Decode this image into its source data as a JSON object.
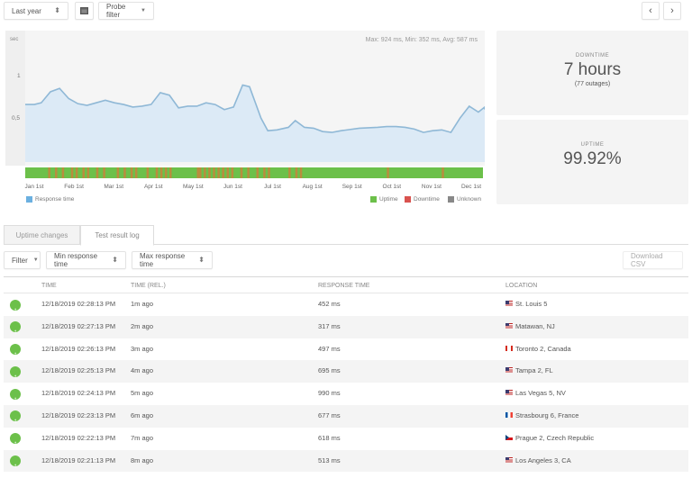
{
  "toolbar": {
    "range_select": "Last year",
    "calendar_icon": "calendar-icon",
    "probe_filter": "Probe filter",
    "prev_icon": "chevron-left-icon",
    "next_icon": "chevron-right-icon",
    "prev_glyph": "‹",
    "next_glyph": "›",
    "sort_glyph": "⬍",
    "caret_glyph": "▼"
  },
  "chart": {
    "summary": "Max: 924 ms, Min: 352 ms, Avg: 587 ms",
    "legend_response": "Response time",
    "legend_uptime": "Uptime",
    "legend_downtime": "Downtime",
    "legend_unknown": "Unknown",
    "colors": {
      "line": "#8fb8d6",
      "fill": "#dceaf6",
      "uptime": "#6cc04a",
      "downtime": "#d9534f",
      "partial": "#c8823c",
      "unknown": "#888888",
      "response_legend": "#6bb0e0"
    }
  },
  "chart_data": {
    "type": "area",
    "title": "",
    "ylabel": "sec",
    "ytick_labels": [
      "sec",
      "1",
      "0,5"
    ],
    "ylim": [
      0,
      1.5
    ],
    "x_labels": [
      "Jan 1st",
      "Feb 1st",
      "Mar 1st",
      "Apr 1st",
      "May 1st",
      "Jun 1st",
      "Jul 1st",
      "Aug 1st",
      "Sep 1st",
      "Oct 1st",
      "Nov 1st",
      "Dec 1st"
    ],
    "x_range": [
      0,
      1
    ],
    "series": [
      {
        "name": "Response time",
        "x": [
          0,
          0.02,
          0.035,
          0.055,
          0.075,
          0.095,
          0.115,
          0.135,
          0.155,
          0.175,
          0.195,
          0.215,
          0.235,
          0.255,
          0.275,
          0.295,
          0.315,
          0.335,
          0.355,
          0.375,
          0.395,
          0.415,
          0.435,
          0.455,
          0.475,
          0.49,
          0.515,
          0.53,
          0.55,
          0.575,
          0.59,
          0.61,
          0.63,
          0.65,
          0.67,
          0.69,
          0.73,
          0.77,
          0.79,
          0.81,
          0.83,
          0.85,
          0.87,
          0.89,
          0.91,
          0.93,
          0.95,
          0.97,
          0.99,
          1.01,
          1.025
        ],
        "values": [
          0.68,
          0.68,
          0.7,
          0.83,
          0.87,
          0.75,
          0.69,
          0.67,
          0.7,
          0.73,
          0.7,
          0.68,
          0.65,
          0.66,
          0.68,
          0.82,
          0.79,
          0.64,
          0.66,
          0.66,
          0.7,
          0.68,
          0.62,
          0.65,
          0.91,
          0.89,
          0.52,
          0.37,
          0.38,
          0.41,
          0.49,
          0.41,
          0.4,
          0.36,
          0.35,
          0.37,
          0.4,
          0.41,
          0.42,
          0.42,
          0.41,
          0.39,
          0.35,
          0.37,
          0.38,
          0.35,
          0.52,
          0.66,
          0.59,
          0.65,
          0.62
        ]
      }
    ],
    "status_bar": {
      "legend": [
        "Uptime",
        "Downtime",
        "Unknown"
      ],
      "partial_outage_positions": [
        0.05,
        0.065,
        0.08,
        0.1,
        0.11,
        0.125,
        0.135,
        0.155,
        0.17,
        0.2,
        0.215,
        0.23,
        0.24,
        0.265,
        0.285,
        0.295,
        0.305,
        0.315,
        0.375,
        0.38,
        0.39,
        0.4,
        0.41,
        0.42,
        0.43,
        0.44,
        0.45,
        0.47,
        0.485,
        0.505,
        0.52,
        0.53,
        0.575,
        0.59,
        0.6,
        0.79,
        0.91
      ]
    }
  },
  "stats": {
    "downtime_label": "DOWNTIME",
    "downtime_value": "7 hours",
    "downtime_sub": "(77 outages)",
    "uptime_label": "UPTIME",
    "uptime_value": "99.92%"
  },
  "tabs": [
    {
      "label": "Uptime changes",
      "active": false
    },
    {
      "label": "Test result log",
      "active": true
    }
  ],
  "filters": {
    "filter": "Filter",
    "min_response": "Min response time",
    "max_response": "Max response time",
    "download_csv": "Download CSV"
  },
  "table": {
    "headers": [
      "",
      "TIME",
      "TIME (REL.)",
      "RESPONSE TIME",
      "LOCATION"
    ],
    "status_glyph": "↑",
    "rows": [
      {
        "status": "up",
        "time": "12/18/2019 02:28:13 PM",
        "rel": "1m ago",
        "response": "452 ms",
        "flag": "us",
        "location": "St. Louis 5"
      },
      {
        "status": "up",
        "time": "12/18/2019 02:27:13 PM",
        "rel": "2m ago",
        "response": "317 ms",
        "flag": "us",
        "location": "Matawan, NJ"
      },
      {
        "status": "up",
        "time": "12/18/2019 02:26:13 PM",
        "rel": "3m ago",
        "response": "497 ms",
        "flag": "ca",
        "location": "Toronto 2, Canada"
      },
      {
        "status": "up",
        "time": "12/18/2019 02:25:13 PM",
        "rel": "4m ago",
        "response": "695 ms",
        "flag": "us",
        "location": "Tampa 2, FL"
      },
      {
        "status": "up",
        "time": "12/18/2019 02:24:13 PM",
        "rel": "5m ago",
        "response": "990 ms",
        "flag": "us",
        "location": "Las Vegas 5, NV"
      },
      {
        "status": "up",
        "time": "12/18/2019 02:23:13 PM",
        "rel": "6m ago",
        "response": "677 ms",
        "flag": "fr",
        "location": "Strasbourg 6, France"
      },
      {
        "status": "up",
        "time": "12/18/2019 02:22:13 PM",
        "rel": "7m ago",
        "response": "618 ms",
        "flag": "cz",
        "location": "Prague 2, Czech Republic"
      },
      {
        "status": "up",
        "time": "12/18/2019 02:21:13 PM",
        "rel": "8m ago",
        "response": "513 ms",
        "flag": "us",
        "location": "Los Angeles 3, CA"
      }
    ]
  }
}
